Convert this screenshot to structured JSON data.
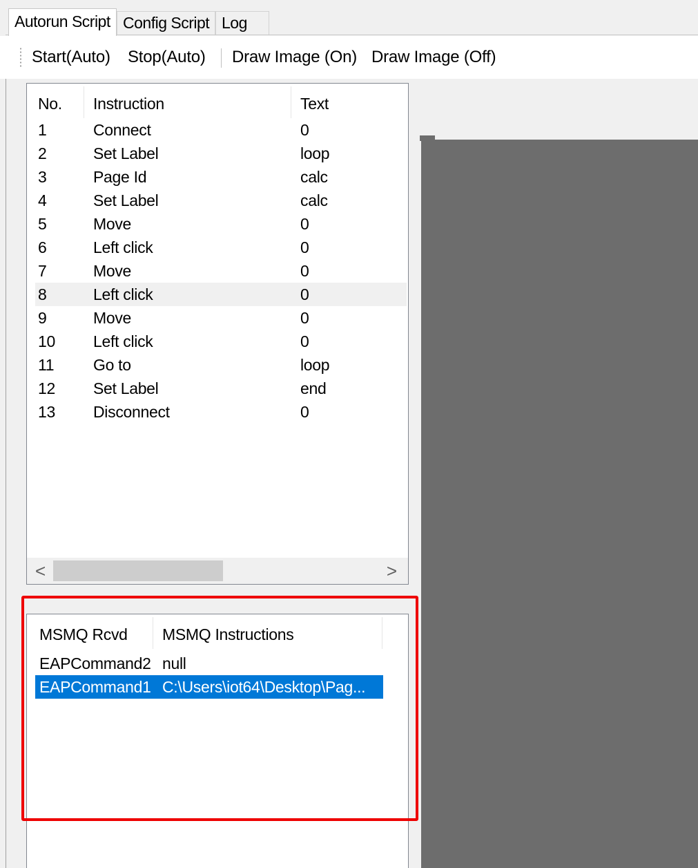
{
  "tabs": [
    {
      "label": "Autorun Script",
      "active": true
    },
    {
      "label": "Config Script",
      "active": false
    },
    {
      "label": "Log",
      "active": false
    }
  ],
  "toolbar": {
    "start_auto": "Start(Auto)",
    "stop_auto": "Stop(Auto)",
    "draw_on": "Draw Image (On)",
    "draw_off": "Draw Image (Off)"
  },
  "script_list": {
    "columns": [
      "No.",
      "Instruction",
      "Text"
    ],
    "rows": [
      {
        "no": "1",
        "instruction": "Connect",
        "text": "0"
      },
      {
        "no": "2",
        "instruction": "Set Label",
        "text": "loop"
      },
      {
        "no": "3",
        "instruction": "Page Id",
        "text": "calc"
      },
      {
        "no": "4",
        "instruction": "Set Label",
        "text": "calc"
      },
      {
        "no": "5",
        "instruction": "Move",
        "text": "0"
      },
      {
        "no": "6",
        "instruction": "Left click",
        "text": "0"
      },
      {
        "no": "7",
        "instruction": "Move",
        "text": "0"
      },
      {
        "no": "8",
        "instruction": "Left click",
        "text": "0"
      },
      {
        "no": "9",
        "instruction": "Move",
        "text": "0"
      },
      {
        "no": "10",
        "instruction": "Left click",
        "text": "0"
      },
      {
        "no": "11",
        "instruction": "Go to",
        "text": "loop"
      },
      {
        "no": "12",
        "instruction": "Set Label",
        "text": "end"
      },
      {
        "no": "13",
        "instruction": "Disconnect",
        "text": "0"
      }
    ],
    "selected_row": 8,
    "scroll_left": "<",
    "scroll_right": ">"
  },
  "msmq_list": {
    "columns": [
      "MSMQ Rcvd",
      "MSMQ Instructions"
    ],
    "rows": [
      {
        "rcvd": "EAPCommand2",
        "instructions": "null"
      },
      {
        "rcvd": "EAPCommand1",
        "instructions": "C:\\Users\\iot64\\Desktop\\Pag..."
      }
    ],
    "selected_row": 2
  },
  "colors": {
    "selection_blue": "#0078d7",
    "highlight_red": "#ee0000",
    "canvas_gray": "#6d6d6d"
  }
}
